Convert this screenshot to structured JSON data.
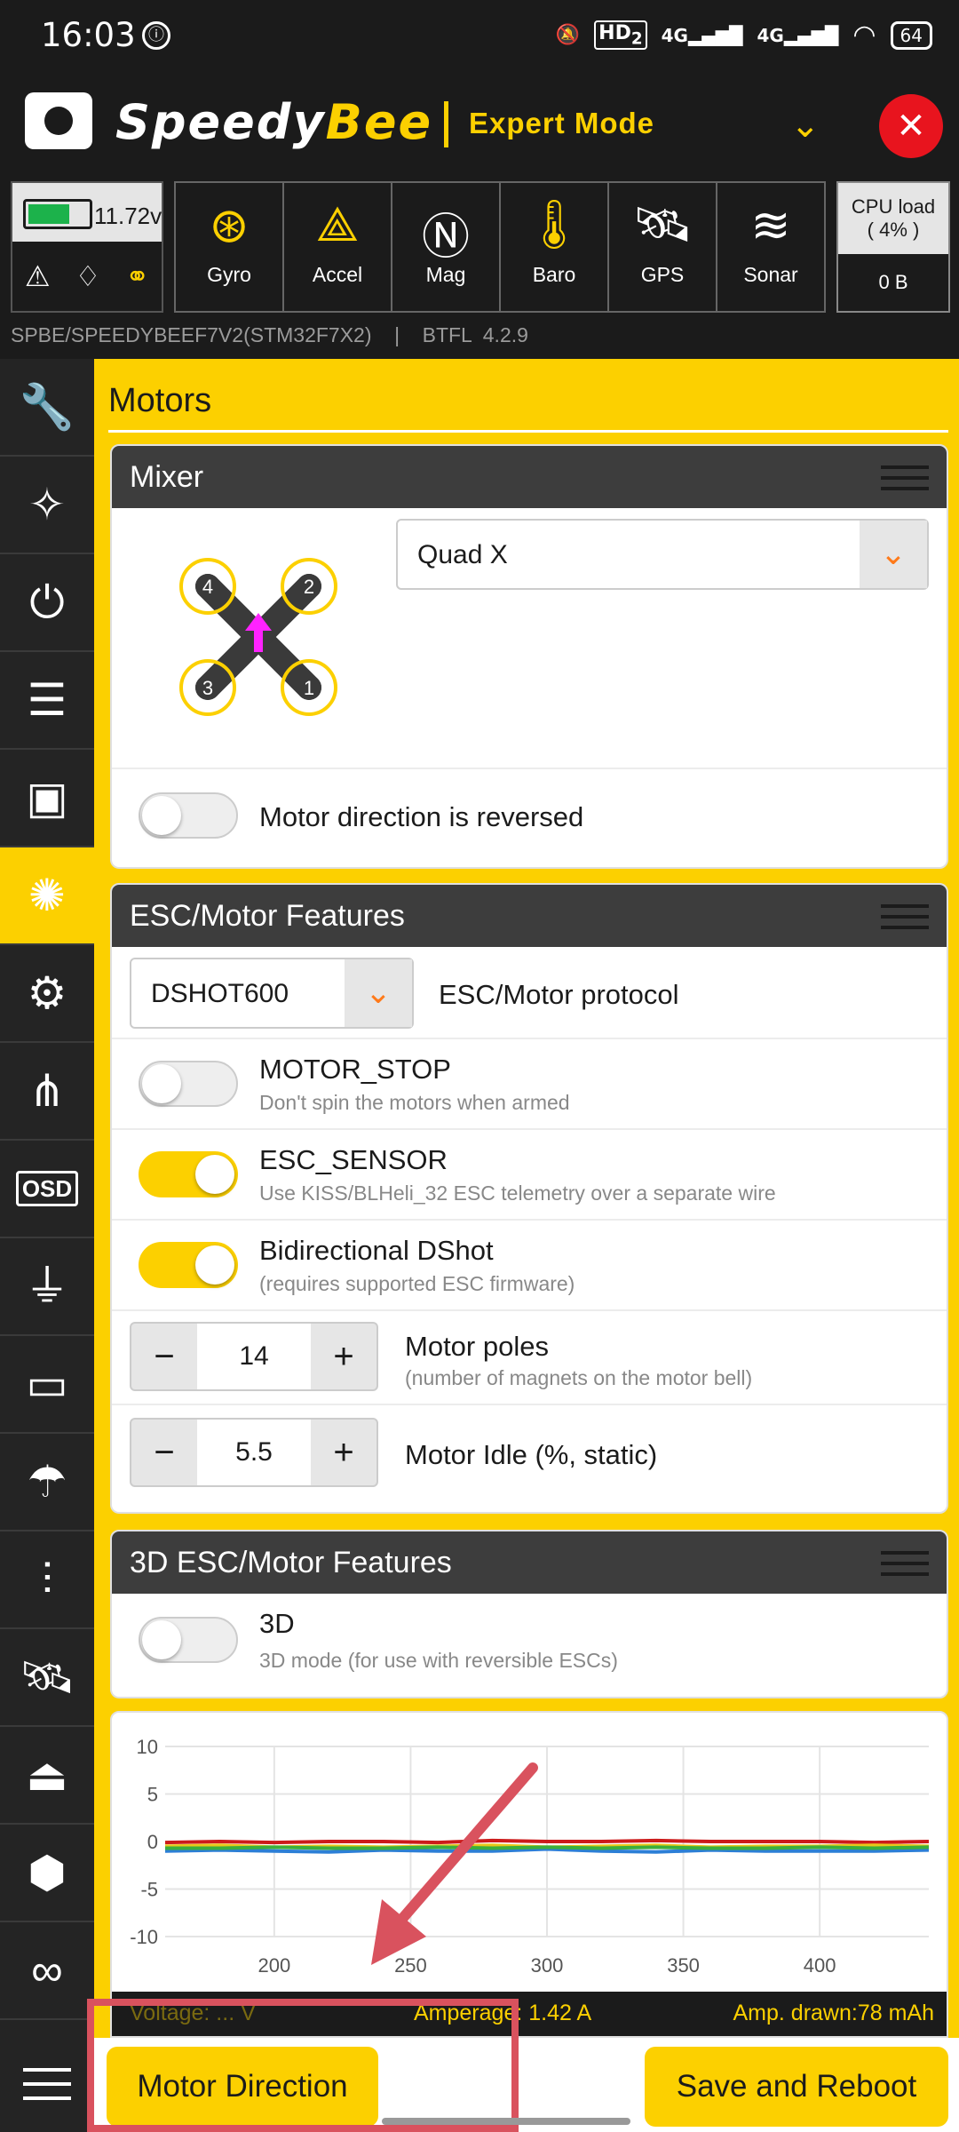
{
  "status_bar": {
    "time": "16:03",
    "network_1": "4G",
    "network_2": "4G",
    "hd_label": "HD",
    "hd_sub": "2",
    "battery": "64"
  },
  "header": {
    "brand_first": "Speedy",
    "brand_second": "Bee",
    "mode": "Expert Mode"
  },
  "sensors": {
    "voltage": "11.72v",
    "battery_fill": 0.7,
    "items": [
      {
        "label": "Gyro",
        "icon": "gyro-icon",
        "active": true
      },
      {
        "label": "Accel",
        "icon": "accel-icon",
        "active": true
      },
      {
        "label": "Mag",
        "icon": "compass-icon",
        "active": false
      },
      {
        "label": "Baro",
        "icon": "thermometer-icon",
        "active": true
      },
      {
        "label": "GPS",
        "icon": "satellite-icon",
        "active": false
      },
      {
        "label": "Sonar",
        "icon": "sonar-icon",
        "active": false
      }
    ],
    "cpu_label": "CPU load",
    "cpu_value": "( 4% )",
    "memory": "0 B"
  },
  "firmware": {
    "board": "SPBE/SPEEDYBEEF7V2(STM32F7X2)",
    "separator": "|",
    "version": "BTFL  4.2.9"
  },
  "sidebar": {
    "osd_label": "OSD"
  },
  "page": {
    "title": "Motors"
  },
  "mixer": {
    "title": "Mixer",
    "selected": "Quad X",
    "motor_labels": [
      "4",
      "2",
      "3",
      "1"
    ],
    "reversed_label": "Motor direction is reversed",
    "reversed": false
  },
  "esc": {
    "title": "ESC/Motor Features",
    "protocol_value": "DSHOT600",
    "protocol_label": "ESC/Motor protocol",
    "motor_stop": {
      "title": "MOTOR_STOP",
      "sub": "Don't spin the motors when armed",
      "on": false
    },
    "esc_sensor": {
      "title": "ESC_SENSOR",
      "sub": "Use KISS/BLHeli_32 ESC telemetry over a separate wire",
      "on": true
    },
    "bidir": {
      "title": "Bidirectional DShot",
      "sub": "(requires supported ESC firmware)",
      "on": true
    },
    "poles": {
      "value": "14",
      "title": "Motor poles",
      "sub": "(number of magnets on the motor bell)"
    },
    "idle": {
      "value": "5.5",
      "title": "Motor Idle (%, static)"
    },
    "minus": "−",
    "plus": "+"
  },
  "esc3d": {
    "title": "3D ESC/Motor Features",
    "toggle_title": "3D",
    "sub": "3D mode (for use with reversible ESCs)",
    "on": false
  },
  "chart_data": {
    "type": "line",
    "title": "",
    "xlabel": "",
    "ylabel": "",
    "xlim": [
      160,
      440
    ],
    "ylim": [
      -10,
      10
    ],
    "yticks": [
      "10",
      "5",
      "0",
      "-5",
      "-10"
    ],
    "xticks": [
      "200",
      "250",
      "300",
      "350",
      "400"
    ],
    "x": [
      160,
      180,
      200,
      220,
      240,
      260,
      280,
      300,
      320,
      340,
      360,
      380,
      400,
      420,
      440
    ],
    "series": [
      {
        "color": "#cc1b1b",
        "values": [
          -0.1,
          0.0,
          -0.1,
          0.0,
          0.0,
          -0.1,
          0.1,
          0.0,
          0.0,
          0.1,
          0.0,
          0.0,
          0.0,
          -0.1,
          0.0
        ]
      },
      {
        "color": "#e8c81a",
        "values": [
          -0.5,
          -0.4,
          -0.6,
          -0.5,
          -0.6,
          -0.5,
          -0.4,
          -0.6,
          -0.5,
          -0.4,
          -0.6,
          -0.5,
          -0.5,
          -0.4,
          -0.5
        ]
      },
      {
        "color": "#2c7fd6",
        "values": [
          -1.0,
          -0.9,
          -1.0,
          -1.1,
          -0.9,
          -1.0,
          -1.0,
          -0.8,
          -1.0,
          -1.1,
          -0.9,
          -1.0,
          -1.0,
          -1.0,
          -0.9
        ]
      },
      {
        "color": "#3cae3c",
        "values": [
          -0.7,
          -0.7,
          -0.6,
          -0.7,
          -0.7,
          -0.6,
          -0.7,
          -0.6,
          -0.7,
          -0.6,
          -0.7,
          -0.7,
          -0.6,
          -0.7,
          -0.6
        ]
      }
    ]
  },
  "chart_info": {
    "voltage": "Voltage: ... V",
    "amperage": "Amperage: 1.42  A",
    "drawn": "Amp. drawn:78  mAh"
  },
  "bottom": {
    "motor_direction": "Motor Direction",
    "save_reboot": "Save and Reboot"
  },
  "annotation": {
    "color": "#d9525e"
  }
}
